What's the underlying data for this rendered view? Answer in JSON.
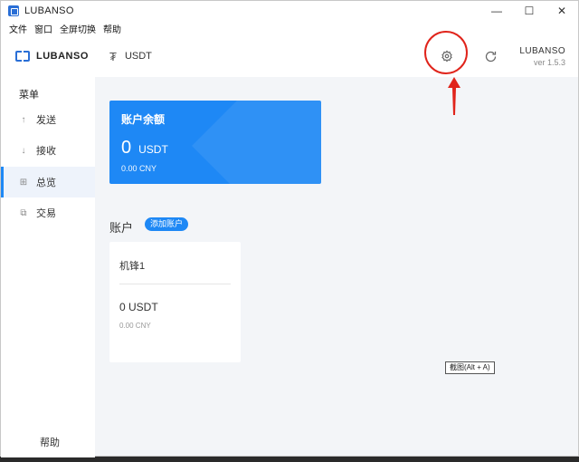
{
  "window": {
    "title": "LUBANSO",
    "minimize": "—",
    "maximize": "☐",
    "close": "✕"
  },
  "menubar": {
    "items": [
      "文件",
      "窗口",
      "全屏切换",
      "帮助"
    ]
  },
  "header": {
    "logo_text": "LUBANSO",
    "currency_symbol": "₮",
    "currency_label": "USDT",
    "brand_name": "LUBANSO",
    "version": "ver 1.5.3",
    "icons": {
      "settings": "gear-icon",
      "refresh": "refresh-icon"
    }
  },
  "sidebar": {
    "title": "菜单",
    "items": [
      {
        "label": "发送",
        "icon": "↑",
        "icon_name": "send-icon"
      },
      {
        "label": "接收",
        "icon": "↓",
        "icon_name": "receive-icon"
      },
      {
        "label": "总览",
        "icon": "⊞",
        "icon_name": "overview-icon",
        "active": true
      },
      {
        "label": "交易",
        "icon": "⧉",
        "icon_name": "transactions-icon"
      }
    ],
    "help": "帮助"
  },
  "balance": {
    "title": "账户余额",
    "amount": "0",
    "unit": "USDT",
    "cny": "0.00 CNY"
  },
  "accounts": {
    "title": "账户",
    "add_label": "添加账户",
    "items": [
      {
        "name": "机锋1",
        "amount": "0 USDT",
        "cny": "0.00 CNY"
      }
    ]
  },
  "tooltip": "截图(Alt + A)",
  "colors": {
    "accent": "#1e88f5",
    "annotation": "#e0241b",
    "sidebar_active_bg": "#eef3fb",
    "page_bg": "#f3f5f8"
  }
}
